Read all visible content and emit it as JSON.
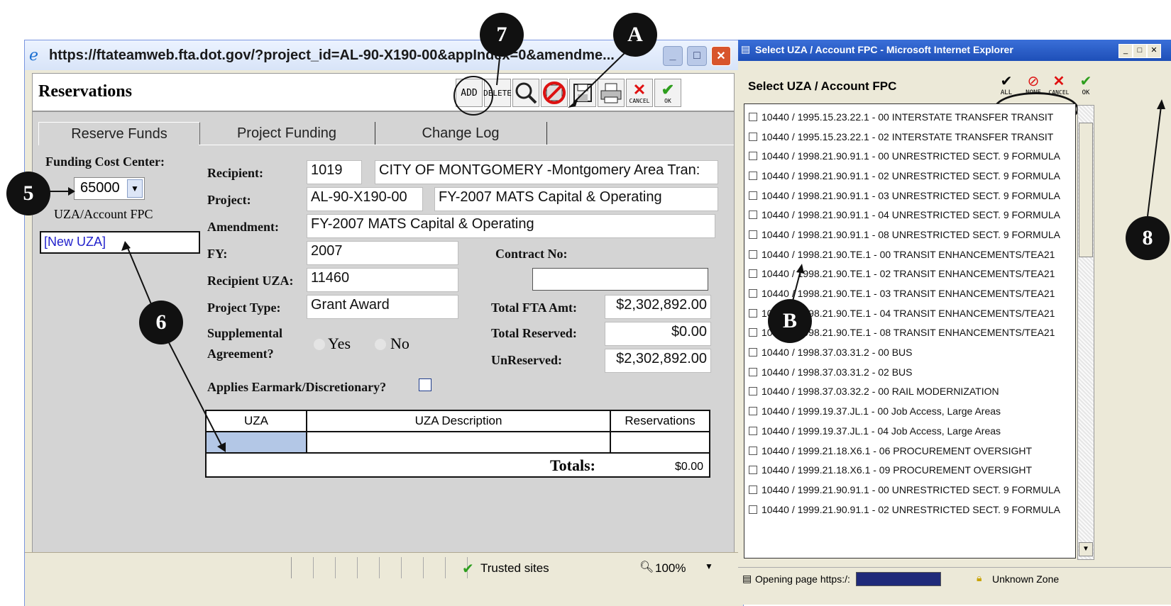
{
  "main_window": {
    "title": "https://ftateamweb.fta.dot.gov/?project_id=AL-90-X190-00&appIndex=0&amendme...",
    "heading": "Reservations",
    "toolbar": {
      "add_label": "ADD",
      "delete_label": "DELETE",
      "cancel_label": "CANCEL",
      "ok_label": "OK"
    },
    "tabs": [
      "Reserve Funds",
      "Project Funding",
      "Change Log"
    ],
    "left": {
      "funding_cost_center_label": "Funding Cost Center:",
      "funding_cost_center_value": "65000",
      "uza_label": "UZA/Account FPC",
      "uza_value": "[New UZA]"
    },
    "form": {
      "recipient_label": "Recipient:",
      "recipient_id": "1019",
      "recipient_name": "CITY OF MONTGOMERY -Montgomery Area Tran:",
      "project_label": "Project:",
      "project_id": "AL-90-X190-00",
      "project_name": "FY-2007 MATS Capital & Operating",
      "amendment_label": "Amendment:",
      "amendment_value": "FY-2007 MATS Capital & Operating",
      "fy_label": "FY:",
      "fy_value": "2007",
      "contract_label": "Contract No:",
      "contract_value": "",
      "recipient_uza_label": "Recipient UZA:",
      "recipient_uza_value": "11460",
      "project_type_label": "Project Type:",
      "project_type_value": "Grant Award",
      "total_fta_label": "Total FTA Amt:",
      "total_fta_value": "$2,302,892.00",
      "supplemental_label_1": "Supplemental",
      "supplemental_label_2": "Agreement?",
      "yes_label": "Yes",
      "no_label": "No",
      "total_reserved_label": "Total Reserved:",
      "total_reserved_value": "$0.00",
      "unreserved_label": "UnReserved:",
      "unreserved_value": "$2,302,892.00",
      "earmark_label": "Applies Earmark/Discretionary?"
    },
    "table": {
      "headers": [
        "UZA",
        "UZA Description",
        "Reservations"
      ],
      "totals_label": "Totals:",
      "totals_value": "$0.00"
    },
    "statusbar": {
      "zone": "Trusted sites",
      "zoom": "100%"
    }
  },
  "popup": {
    "title": "Select UZA / Account FPC - Microsoft Internet Explorer",
    "heading": "Select UZA / Account FPC",
    "buttons": {
      "all": "ALL",
      "none": "NONE",
      "cancel": "CANCEL",
      "ok": "OK"
    },
    "items": [
      "10440 / 1995.15.23.22.1 - 00 INTERSTATE TRANSFER TRANSIT",
      "10440 / 1995.15.23.22.1 - 02 INTERSTATE TRANSFER TRANSIT",
      "10440 / 1998.21.90.91.1 - 00 UNRESTRICTED SECT. 9 FORMULA",
      "10440 / 1998.21.90.91.1 - 02 UNRESTRICTED SECT. 9 FORMULA",
      "10440 / 1998.21.90.91.1 - 03 UNRESTRICTED SECT. 9 FORMULA",
      "10440 / 1998.21.90.91.1 - 04 UNRESTRICTED SECT. 9 FORMULA",
      "10440 / 1998.21.90.91.1 - 08 UNRESTRICTED SECT. 9 FORMULA",
      "10440 / 1998.21.90.TE.1 - 00 TRANSIT ENHANCEMENTS/TEA21",
      "10440 / 1998.21.90.TE.1 - 02 TRANSIT ENHANCEMENTS/TEA21",
      "10440 / 1998.21.90.TE.1 - 03 TRANSIT ENHANCEMENTS/TEA21",
      "10440 / 1998.21.90.TE.1 - 04 TRANSIT ENHANCEMENTS/TEA21",
      "10440 / 1998.21.90.TE.1 - 08 TRANSIT ENHANCEMENTS/TEA21",
      "10440 / 1998.37.03.31.2 - 00 BUS",
      "10440 / 1998.37.03.31.2 - 02 BUS",
      "10440 / 1998.37.03.32.2 - 00 RAIL MODERNIZATION",
      "10440 / 1999.19.37.JL.1 - 00 Job Access, Large Areas",
      "10440 / 1999.19.37.JL.1 - 04 Job Access, Large Areas",
      "10440 / 1999.21.18.X6.1 - 06 PROCUREMENT OVERSIGHT",
      "10440 / 1999.21.18.X6.1 - 09 PROCUREMENT OVERSIGHT",
      "10440 / 1999.21.90.91.1 - 00 UNRESTRICTED SECT. 9 FORMULA",
      "10440 / 1999.21.90.91.1 - 02 UNRESTRICTED SECT. 9 FORMULA"
    ],
    "status_text": "Opening page https:/:",
    "zone": "Unknown Zone"
  },
  "callouts": {
    "c7": "7",
    "cA": "A",
    "c5": "5",
    "c6": "6",
    "c8": "8",
    "cB": "B"
  }
}
